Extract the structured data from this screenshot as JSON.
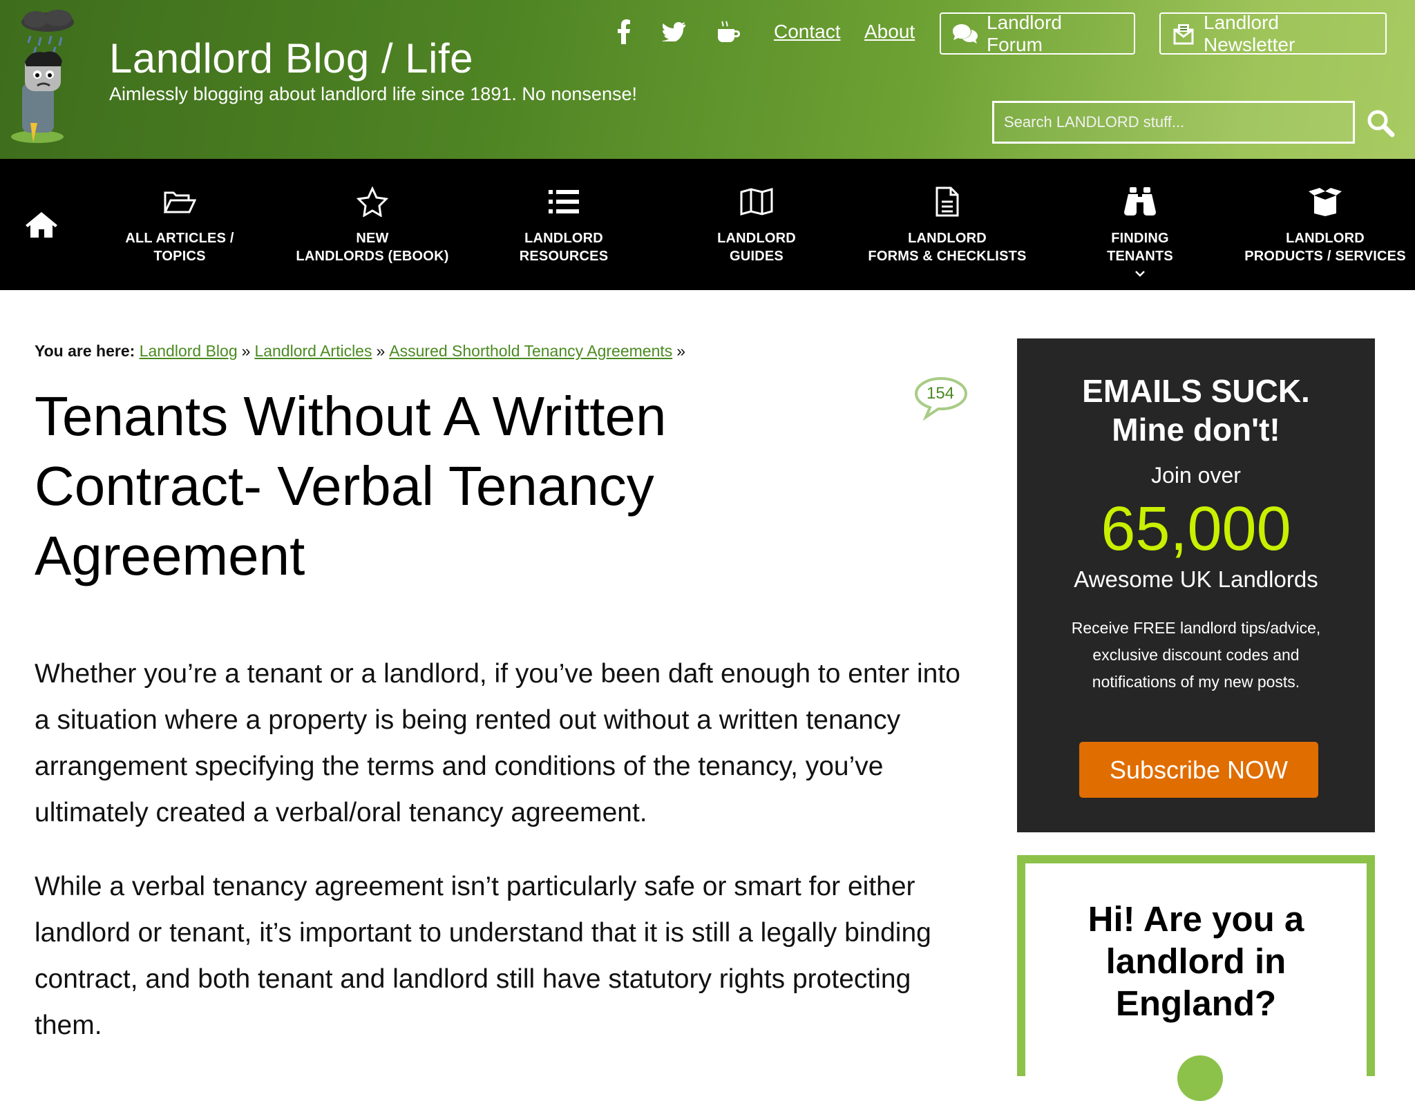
{
  "header": {
    "site_title": "Landlord Blog / Life",
    "tagline": "Aimlessly blogging about landlord life since 1891. No nonsense!",
    "social_icons": [
      "facebook-icon",
      "twitter-icon",
      "coffee-icon"
    ],
    "links": {
      "contact": "Contact",
      "about": "About"
    },
    "forum_button": "Landlord Forum",
    "newsletter_button": "Landlord Newsletter",
    "search_placeholder": "Search LANDLORD stuff...",
    "colors": {
      "header_dark": "#3e6d1c",
      "header_light": "#a8cb62"
    }
  },
  "nav": {
    "home_icon": "home-icon",
    "items": [
      {
        "label": "ALL ARTICLES /\nTOPICS",
        "icon": "folder-open-icon"
      },
      {
        "label": "NEW\nLANDLORDS (EBOOK)",
        "icon": "star-icon"
      },
      {
        "label": "LANDLORD\nRESOURCES",
        "icon": "list-icon"
      },
      {
        "label": "LANDLORD\nGUIDES",
        "icon": "map-icon"
      },
      {
        "label": "LANDLORD\nFORMS & CHECKLISTS",
        "icon": "document-icon"
      },
      {
        "label": "FINDING\nTENANTS",
        "icon": "binoculars-icon",
        "has_dropdown": true
      },
      {
        "label": "LANDLORD\nPRODUCTS / SERVICES",
        "icon": "open-box-icon"
      }
    ]
  },
  "breadcrumb": {
    "prefix": "You are here:",
    "items": [
      "Landlord Blog",
      "Landlord Articles",
      "Assured Shorthold Tenancy Agreements"
    ],
    "separator": "»"
  },
  "post": {
    "title": "Tenants Without A Written Contract- Verbal Tenancy Agreement",
    "comment_count": "154",
    "paragraphs": [
      "Whether you’re a tenant or a landlord, if you’ve been daft enough to enter into a situation where a property is being rented out without a written tenancy arrangement specifying the terms and conditions of the tenancy, you’ve ultimately created a verbal/oral tenancy agreement.",
      "While a verbal tenancy agreement isn’t particularly safe or smart for either landlord or tenant, it’s important to understand that it is still a legally binding contract, and both tenant and landlord still have statutory rights protecting them."
    ]
  },
  "sidebar": {
    "promo": {
      "headline": "EMAILS SUCK.\nMine don't!",
      "join": "Join over",
      "number": "65,000",
      "sub": "Awesome UK Landlords",
      "description": "Receive FREE landlord tips/advice, exclusive discount codes and notifications of my new posts.",
      "button": "Subscribe NOW",
      "colors": {
        "background": "#262626",
        "number": "#c8f000",
        "button": "#e06d00"
      }
    },
    "survey": {
      "question": "Hi! Are you a landlord in England?",
      "colors": {
        "border": "#8cc24a"
      }
    }
  }
}
